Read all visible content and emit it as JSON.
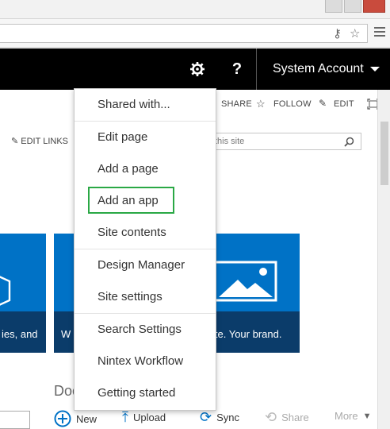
{
  "suitebar": {
    "help_label": "?",
    "account_name": "System Account"
  },
  "ribbon": {
    "share": "SHARE",
    "follow": "FOLLOW",
    "edit": "EDIT"
  },
  "nav": {
    "edit_links": "EDIT LINKS",
    "search_placeholder": "this site"
  },
  "tiles": {
    "left_text": "ies, and",
    "middle_text": "W",
    "right_text": "ite. Your brand."
  },
  "documents": {
    "title": "Doc",
    "commands": [
      "New",
      "Upload",
      "Sync",
      "Share",
      "More"
    ]
  },
  "settings_menu": {
    "items": [
      "Shared with...",
      "Edit page",
      "Add a page",
      "Add an app",
      "Site contents",
      "Design Manager",
      "Site settings",
      "Search Settings",
      "Nintex Workflow",
      "Getting started"
    ],
    "highlighted": "Add an app"
  },
  "colors": {
    "suitebar": "#000000",
    "tile": "#0072c6",
    "tile_band": "#0b3c6a",
    "highlight": "#2aa845"
  }
}
